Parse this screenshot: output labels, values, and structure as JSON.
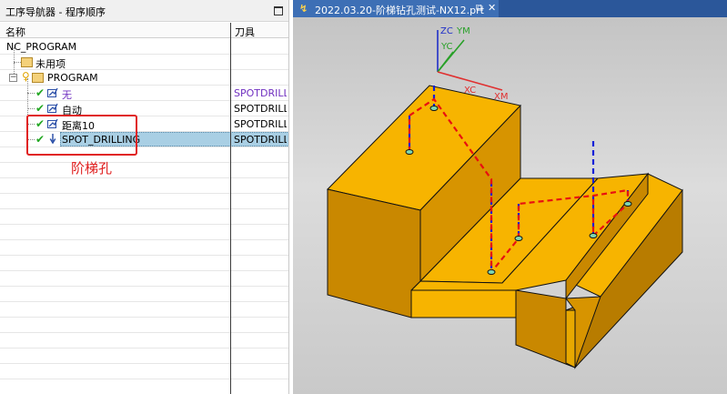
{
  "navigator": {
    "title": "工序导航器 - 程序顺序",
    "columns": {
      "name": "名称",
      "tool": "刀具"
    },
    "rows": [
      {
        "label": "NC_PROGRAM",
        "tool": ""
      },
      {
        "label": "未用项",
        "tool": ""
      },
      {
        "label": "PROGRAM",
        "tool": ""
      },
      {
        "label": "无",
        "tool": "SPOTDRILLI"
      },
      {
        "label": "自动",
        "tool": "SPOTDRILLI"
      },
      {
        "label": "距离10",
        "tool": "SPOTDRILLI"
      },
      {
        "label": "SPOT_DRILLING",
        "tool": "SPOTDRILLI"
      }
    ],
    "annotation": "阶梯孔"
  },
  "graphics": {
    "tab_title": "2022.03.20-阶梯钻孔测试-NX12.prt",
    "axes": {
      "zc": "ZC",
      "ym": "YM",
      "yc": "YC",
      "xc": "XC",
      "xm": "XM"
    }
  },
  "colors": {
    "part": "#f7b400",
    "part_side": "#c98800",
    "path": "#e81010",
    "approach": "#1020d8",
    "check": "#22a722",
    "annotation": "#e02020"
  }
}
